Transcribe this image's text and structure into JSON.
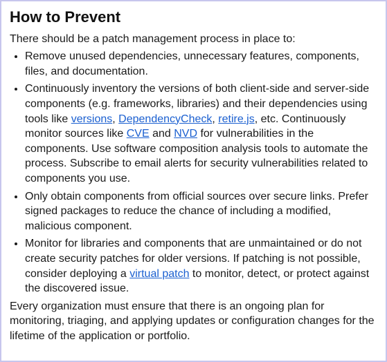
{
  "title": "How to Prevent",
  "intro": "There should be a patch management process in place to:",
  "bullets": [
    {
      "segments": [
        {
          "text": "Remove unused dependencies, unnecessary features, components, files, and documentation."
        }
      ]
    },
    {
      "segments": [
        {
          "text": "Continuously inventory the versions of both client-side and server-side components (e.g. frameworks, libraries) and their dependencies using tools like "
        },
        {
          "text": "versions",
          "link": true,
          "name": "link-versions"
        },
        {
          "text": ", "
        },
        {
          "text": "DependencyCheck",
          "link": true,
          "name": "link-dependencycheck"
        },
        {
          "text": ", "
        },
        {
          "text": "retire.js",
          "link": true,
          "name": "link-retirejs"
        },
        {
          "text": ", etc. Continuously monitor sources like "
        },
        {
          "text": "CVE",
          "link": true,
          "name": "link-cve"
        },
        {
          "text": " and "
        },
        {
          "text": "NVD",
          "link": true,
          "name": "link-nvd"
        },
        {
          "text": " for vulnerabilities in the components. Use software composition analysis tools to automate the process. Subscribe to email alerts for security vulnerabilities related to components you use."
        }
      ]
    },
    {
      "segments": [
        {
          "text": "Only obtain components from official sources over secure links. Prefer signed packages to reduce the chance of including a modified, malicious component."
        }
      ]
    },
    {
      "segments": [
        {
          "text": "Monitor for libraries and components that are unmaintained or do not create security patches for older versions. If patching is not possible, consider deploying a "
        },
        {
          "text": "virtual patch",
          "link": true,
          "name": "link-virtual-patch"
        },
        {
          "text": " to monitor, detect, or protect against the discovered issue."
        }
      ]
    }
  ],
  "outro": "Every organization must ensure that there is an ongoing plan for monitoring, triaging, and applying updates or configuration changes for the lifetime of the application or portfolio."
}
